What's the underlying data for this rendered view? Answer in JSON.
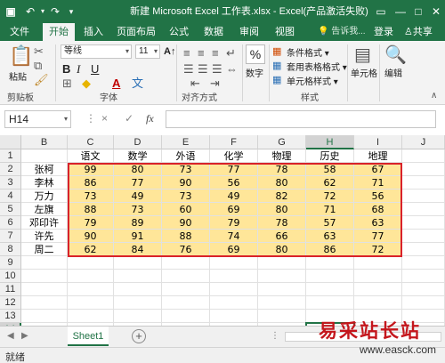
{
  "app": {
    "title": "新建 Microsoft Excel 工作表.xlsx - Excel(产品激活失败)",
    "accent": "#217346"
  },
  "tabs": [
    "文件",
    "开始",
    "插入",
    "页面布局",
    "公式",
    "数据",
    "审阅",
    "视图"
  ],
  "active_tab": "开始",
  "tellme": "告诉我...",
  "login": "登录",
  "share": "共享",
  "ribbon": {
    "paste": "粘贴",
    "clipboard": "剪贴板",
    "font_name": "等线",
    "font_size": "11",
    "font_group": "字体",
    "align_group": "对齐方式",
    "number": "数字",
    "conditional": "条件格式",
    "table_format": "套用表格格式",
    "cell_style": "单元格样式",
    "style_group": "样式",
    "cells": "单元格",
    "editing": "编辑"
  },
  "formula_bar": {
    "name_box": "H14",
    "fx": "fx",
    "cancel": "×",
    "confirm": "✓"
  },
  "grid": {
    "columns": [
      "B",
      "C",
      "D",
      "E",
      "F",
      "G",
      "H",
      "I",
      "J"
    ],
    "rows": [
      "1",
      "2",
      "3",
      "4",
      "5",
      "6",
      "7",
      "8",
      "9",
      "10",
      "11",
      "12",
      "13",
      "14"
    ],
    "header": [
      "语文",
      "数学",
      "外语",
      "化学",
      "物理",
      "历史",
      "地理"
    ],
    "data": [
      {
        "name": "张柯",
        "scores": [
          "99",
          "80",
          "73",
          "77",
          "78",
          "58",
          "67"
        ]
      },
      {
        "name": "李林",
        "scores": [
          "86",
          "77",
          "90",
          "56",
          "80",
          "62",
          "71"
        ]
      },
      {
        "name": "万力",
        "scores": [
          "73",
          "49",
          "73",
          "49",
          "82",
          "72",
          "56"
        ]
      },
      {
        "name": "左旗",
        "scores": [
          "88",
          "73",
          "60",
          "69",
          "80",
          "71",
          "68"
        ]
      },
      {
        "name": "邓印许",
        "scores": [
          "79",
          "89",
          "90",
          "79",
          "78",
          "57",
          "63"
        ]
      },
      {
        "name": "许先",
        "scores": [
          "90",
          "91",
          "88",
          "74",
          "66",
          "63",
          "77"
        ]
      },
      {
        "name": "周二",
        "scores": [
          "62",
          "84",
          "76",
          "69",
          "80",
          "86",
          "72"
        ]
      }
    ],
    "selected_cell": "H14"
  },
  "sheets": [
    "Sheet1"
  ],
  "status": "就绪",
  "watermark": {
    "text": "易采站长站",
    "url": "www.easck.com"
  }
}
